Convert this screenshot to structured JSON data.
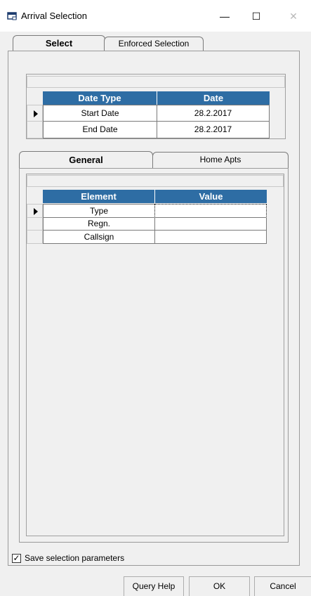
{
  "window": {
    "title": "Arrival Selection",
    "minimize_glyph": "—",
    "maximize_glyph": "☐",
    "close_glyph": "✕"
  },
  "outer_tabs": [
    {
      "label": "Select",
      "active": true
    },
    {
      "label": "Enforced Selection",
      "active": false
    }
  ],
  "date_grid": {
    "columns": [
      "Date Type",
      "Date"
    ],
    "rows": [
      {
        "type": "Start Date",
        "date": "28.2.2017"
      },
      {
        "type": "End Date",
        "date": "28.2.2017"
      }
    ]
  },
  "inner_tabs": [
    {
      "label": "General",
      "active": true
    },
    {
      "label": "Home Apts",
      "active": false
    }
  ],
  "element_grid": {
    "columns": [
      "Element",
      "Value"
    ],
    "rows": [
      {
        "element": "Type",
        "value": ""
      },
      {
        "element": "Regn.",
        "value": ""
      },
      {
        "element": "Callsign",
        "value": ""
      }
    ]
  },
  "save_checkbox": {
    "label": "Save selection parameters",
    "checked": true,
    "mark": "✓"
  },
  "buttons": {
    "query_help": "Query Help",
    "ok": "OK",
    "cancel": "Cancel"
  },
  "colors": {
    "grid_header": "#2e6da4",
    "window_bg": "#f0f0f0"
  }
}
